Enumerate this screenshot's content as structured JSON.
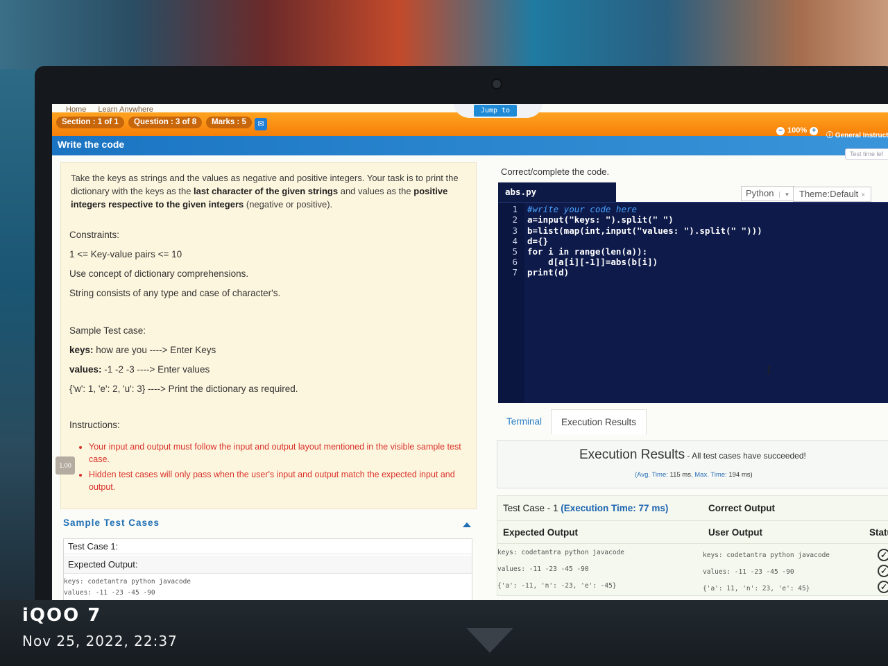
{
  "header": {
    "breadcrumbs": [
      "Home",
      "Learn Anywhere"
    ],
    "section_pill": "Section : 1 of 1",
    "question_pill": "Question : 3 of 8",
    "marks_pill": "Marks : 5",
    "jump_label": "Jump to",
    "zoom_level": "100%",
    "general_instructions": "General Instruct",
    "page_title": "Write the code",
    "test_time_left": "Test time lef"
  },
  "problem": {
    "desc_part1": "Take the keys as strings and the values as negative and positive integers. Your task is to print the dictionary with the keys as the ",
    "desc_bold1": "last character of the given strings",
    "desc_part2": " and values as the ",
    "desc_bold2": "positive integers respective to the given integers",
    "desc_part3": " (negative or positive).",
    "constraints_label": "Constraints:",
    "constraint1": "1 <= Key-value pairs <= 10",
    "constraint2": "Use concept of dictionary comprehensions.",
    "constraint3": "String consists of any type and case of character's.",
    "sample_label": "Sample Test case:",
    "sample_keys_label": "keys:",
    "sample_keys_value": " how are you ----> Enter Keys",
    "sample_values_label": "values:",
    "sample_values_value": " -1 -2 -3 ----> Enter values",
    "sample_output": "{'w': 1, 'e': 2, 'u': 3} ----> Print the dictionary as required.",
    "instructions_label": "Instructions:",
    "instruction1": "Your input and output must follow the input and output layout mentioned in the visible sample test case.",
    "instruction2": "Hidden test cases will only pass when the user's input and output match the expected input and output.",
    "side_badge": "1.00"
  },
  "sample_test_cases": {
    "heading": "Sample Test Cases",
    "test_case_label": "Test Case 1:",
    "expected_output_label": "Expected Output:",
    "line1": "keys:  codetantra python javacode",
    "line2": "values: -11 -23 -45 -90"
  },
  "editor": {
    "instruction": "Correct/complete the code.",
    "file_name": "abs.py",
    "language": "Python",
    "theme": "Theme:Default",
    "line_numbers": [
      "1",
      "2",
      "3",
      "4",
      "5",
      "6",
      "7"
    ],
    "lines": [
      "#write your code here",
      "a=input(\"keys: \").split(\" \")",
      "b=list(map(int,input(\"values: \").split(\" \")))",
      "d={}",
      "for i in range(len(a)):",
      "    d[a[i][-1]]=abs(b[i])",
      "print(d)"
    ]
  },
  "results": {
    "tab_terminal": "Terminal",
    "tab_execution": "Execution Results",
    "title": "Execution Results",
    "subtitle": " - All test cases have succeeded!",
    "avg_label": "(Avg. Time: ",
    "avg_value": "115 ms",
    "max_label": ", Max. Time: ",
    "max_value": "194 ms)",
    "test_case_label": "Test Case - 1 ",
    "exec_time": "(Execution Time: 77 ms)",
    "correct_output": "Correct Output",
    "expected_output": "Expected Output",
    "user_output": "User Output",
    "status": "Statu",
    "expected_lines": [
      "keys:  codetantra python javacode",
      "values: -11 -23 -45 -90",
      "{'a': -11, 'n': -23, 'e': -45}"
    ],
    "user_lines": [
      "keys:  codetantra python javacode",
      "values:  -11 -23 -45 -90",
      "{'a': 11, 'n': 23, 'e': 45}"
    ]
  },
  "watermark": {
    "brand": "iQOO 7",
    "datetime": "Nov 25, 2022, 22:37"
  }
}
